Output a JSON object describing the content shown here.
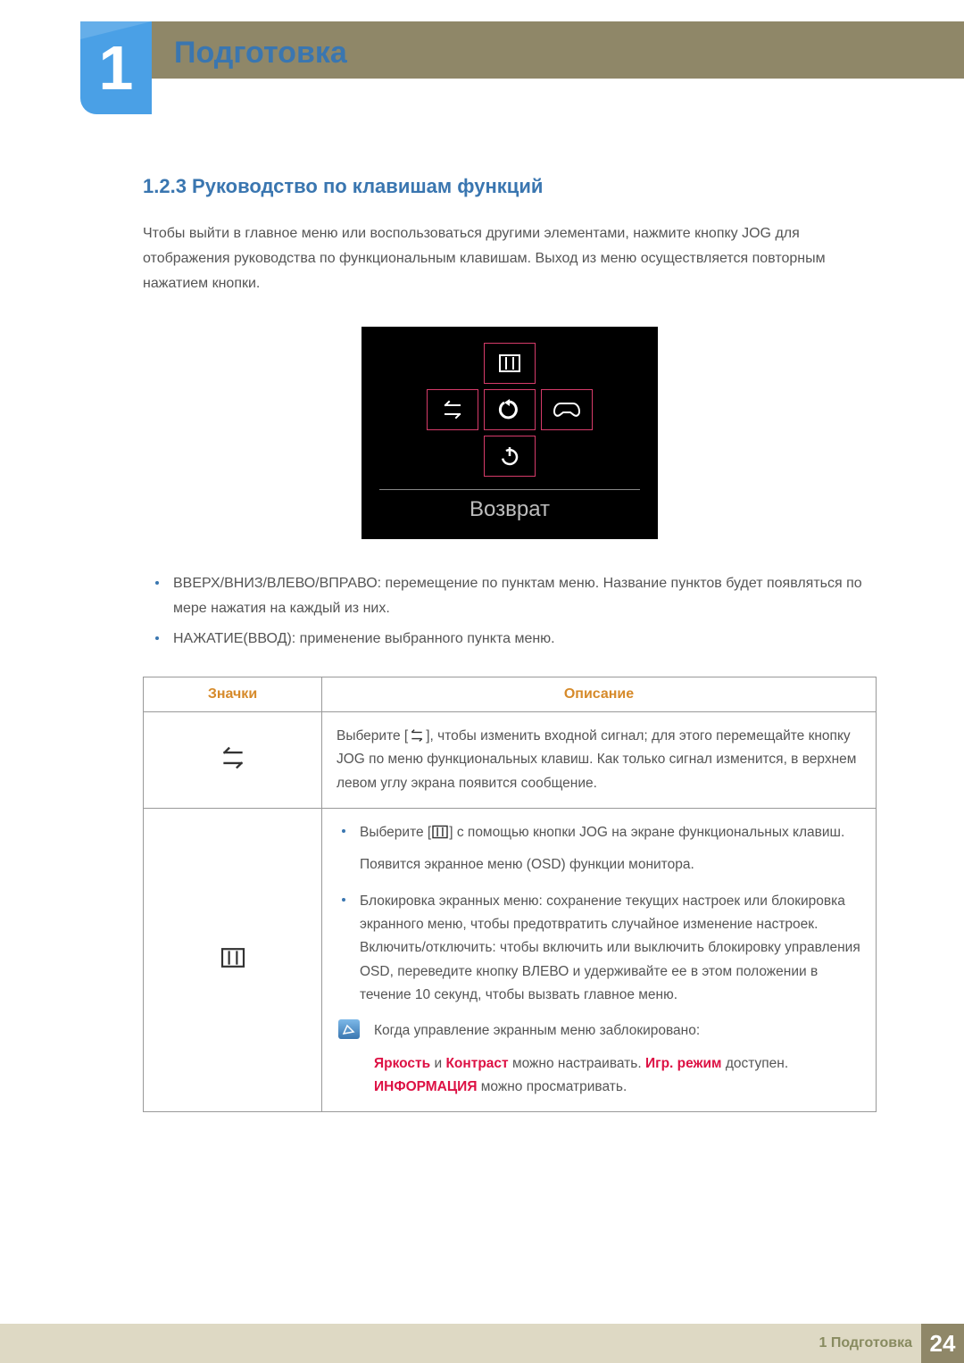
{
  "chapter": {
    "number": "1",
    "title": "Подготовка"
  },
  "section": {
    "heading": "1.2.3 Руководство по клавишам функций",
    "intro": "Чтобы выйти в главное меню или воспользоваться другими элементами, нажмите кнопку JOG для отображения руководства по функциональным клавишам. Выход из меню осуществляется повторным нажатием кнопки."
  },
  "osd": {
    "return_label": "Возврат"
  },
  "bullets": {
    "b1": "ВВЕРХ/ВНИЗ/ВЛЕВО/ВПРАВО: перемещение по пунктам меню. Название пунктов будет появляться по мере нажатия на каждый из них.",
    "b2": "НАЖАТИЕ(ВВОД): применение выбранного пункта меню."
  },
  "table": {
    "th_icons": "Значки",
    "th_desc": "Описание",
    "row1": {
      "pre": "Выберите [",
      "post": "], чтобы изменить входной сигнал; для этого перемещайте кнопку JOG по меню функциональных клавиш. Как только сигнал изменится, в верхнем левом углу экрана появится сообщение."
    },
    "row2": {
      "li1_pre": "Выберите [",
      "li1_post": "] с помощью кнопки JOG на экране функциональных клавиш.",
      "li1_sub": "Появится экранное меню (OSD) функции монитора.",
      "li2": "Блокировка экранных меню: сохранение текущих настроек или блокировка экранного меню, чтобы предотвратить случайное изменение настроек. Включить/отключить: чтобы включить или выключить блокировку управления OSD, переведите кнопку ВЛЕВО и удерживайте ее в этом положении в течение 10 секунд, чтобы вызвать главное меню.",
      "note_lead": "Когда управление экранным меню заблокировано:",
      "note_pre": "",
      "hl_brightness": "Яркость",
      "note_mid1": " и ",
      "hl_contrast": "Контраст",
      "note_mid2": " можно настраивать. ",
      "hl_game": "Игр. режим",
      "note_mid3": " доступен. ",
      "hl_info": "ИНФОРМАЦИЯ",
      "note_end": " можно просматривать."
    }
  },
  "footer": {
    "label": "1 Подготовка",
    "page": "24"
  }
}
